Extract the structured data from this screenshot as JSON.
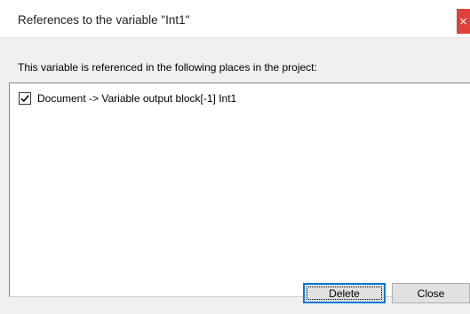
{
  "dialog": {
    "title": "References to the variable \"Int1\"",
    "description": "This variable is referenced in the following places in the project:",
    "close_glyph": "×"
  },
  "references": {
    "items": [
      {
        "label": "Document -> Variable output block[-1] Int1",
        "checked": true
      }
    ]
  },
  "buttons": {
    "delete_label": "Delete",
    "close_label": "Close"
  },
  "colors": {
    "accent": "#0078d7",
    "close_red": "#e0413a",
    "dialog_bg": "#f0f0f0"
  }
}
